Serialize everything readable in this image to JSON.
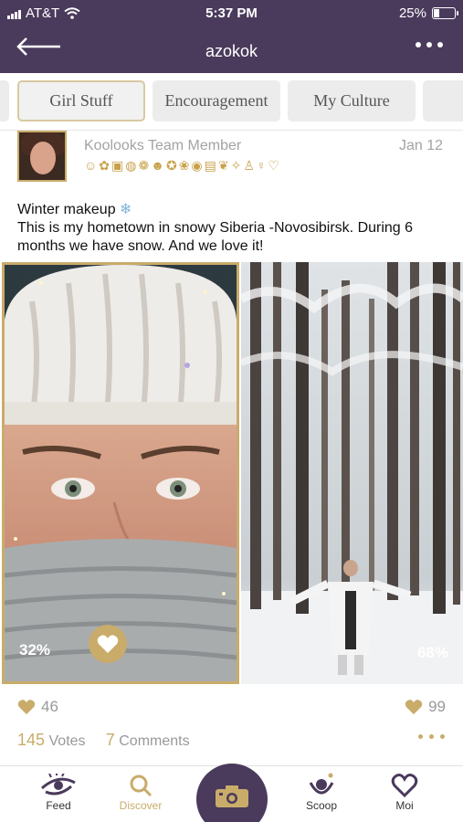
{
  "status_bar": {
    "carrier": "AT&T",
    "time": "5:37 PM",
    "battery": "25%",
    "battery_level": 0.25
  },
  "header": {
    "title": "azokok"
  },
  "tabs": [
    {
      "label": "Girl Stuff",
      "active": true
    },
    {
      "label": "Encouragement",
      "active": false
    },
    {
      "label": "My Culture",
      "active": false
    }
  ],
  "post": {
    "author": "Koolooks Team Member",
    "date": "Jan 12",
    "title": "Winter makeup",
    "body": "This is my hometown in snowy Siberia -Novosibirsk. During 6 months we have snow. And we love it!",
    "left_percent": "32%",
    "right_percent": "68%",
    "likes_left": "46",
    "likes_right": "99",
    "votes_count": "145",
    "votes_label": "Votes",
    "comments_count": "7",
    "comments_label": "Comments"
  },
  "bottom_nav": {
    "feed": "Feed",
    "discover": "Discover",
    "scoop": "Scoop",
    "moi": "Moi"
  },
  "colors": {
    "header": "#4a3a5c",
    "gold": "#c9ac6a"
  }
}
